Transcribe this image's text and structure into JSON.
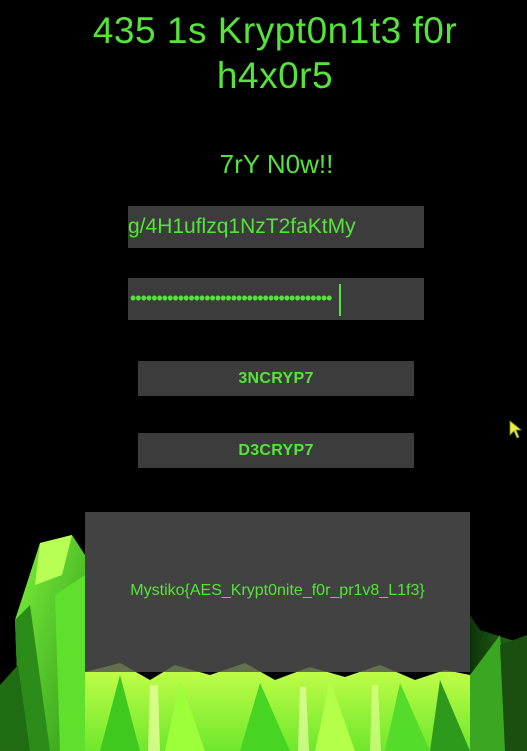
{
  "app": {
    "title": "435 1s Krypt0n1t3 f0r h4x0r5",
    "subtitle": "7rY N0w!!"
  },
  "form": {
    "key_value": "g/4H1uflzq1NzT2faKtMy",
    "password_mask": "••••••••••••••••••••••••••••••••••••••"
  },
  "buttons": {
    "encrypt_label": "3NCRYP7",
    "decrypt_label": "D3CRYP7"
  },
  "output": {
    "text": "Mystiko{AES_Krypt0nite_f0r_pr1v8_L1f3}"
  },
  "colors": {
    "accent": "#55e43a",
    "background": "#000000",
    "field": "#3c3c3c",
    "crystal_light": "#a6ff3a",
    "crystal_mid": "#4fd82a",
    "crystal_dark": "#1b5a12"
  },
  "icons": {
    "pointer": "mouse-pointer-icon",
    "illustration": "kryptonite-crystal-illustration"
  }
}
